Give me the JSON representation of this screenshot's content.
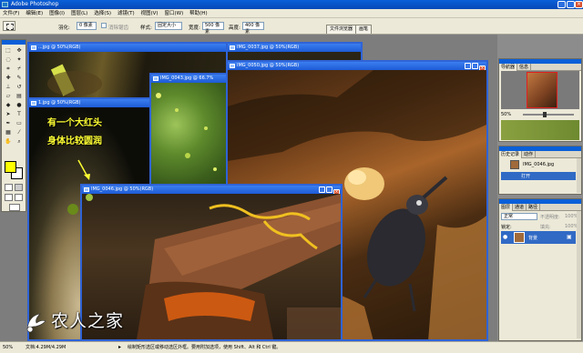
{
  "app": {
    "title": "Adobe Photoshop",
    "close_glyph": "×"
  },
  "menu": [
    "文件(F)",
    "编辑(E)",
    "图像(I)",
    "图层(L)",
    "选择(S)",
    "滤镜(T)",
    "视图(V)",
    "窗口(W)",
    "帮助(H)"
  ],
  "options": {
    "feather_label": "羽化:",
    "feather_value": "0 像素",
    "antialias_label": "消除锯齿",
    "style_label": "样式:",
    "style_value": "固定大小",
    "width_label": "宽度:",
    "width_value": "500 像素",
    "height_label": "高度:",
    "height_value": "400 像素",
    "tabs": [
      "文件浏览器",
      "画笔"
    ]
  },
  "documents": [
    {
      "id": "doc1",
      "title": "...jpg @ 50%(RGB)"
    },
    {
      "id": "doc2",
      "title": "IMG_0037.jpg @ 50%(RGB)"
    },
    {
      "id": "doc3",
      "title": "1.jpg @ 50%(RGB)"
    },
    {
      "id": "doc4",
      "title": "IMG_0043.jpg @ 66.7%"
    },
    {
      "id": "doc5",
      "title": "IMG_0050.jpg @ 50%(RGB)"
    },
    {
      "id": "doc6",
      "title": "IMG_0046.jpg @ 50%(RGB)"
    }
  ],
  "annotations": {
    "line1": "有一个大红头",
    "line2": "身体比较圆润"
  },
  "navigator": {
    "tabs": [
      "导航器",
      "信息"
    ],
    "zoom": "50%"
  },
  "history": {
    "tabs": [
      "历史记录",
      "动作"
    ],
    "snapshot_label": "IMG_0046.jpg",
    "state_label": "打开"
  },
  "layers": {
    "tabs": [
      "图层",
      "通道",
      "路径"
    ],
    "blend_mode": "正常",
    "opacity_label": "不透明度:",
    "opacity_value": "100%",
    "lock_label": "锁定:",
    "fill_label": "填充:",
    "fill_value": "100%",
    "layer_name": "背景"
  },
  "status": {
    "zoom": "50%",
    "doc_info": "文档:4.29M/4.29M",
    "hint": "绘制矩形选区或移动选区外框。要用附加选项，使用 Shift、Alt 和 Ctrl 键。"
  },
  "watermark": {
    "text": "农人之家"
  }
}
